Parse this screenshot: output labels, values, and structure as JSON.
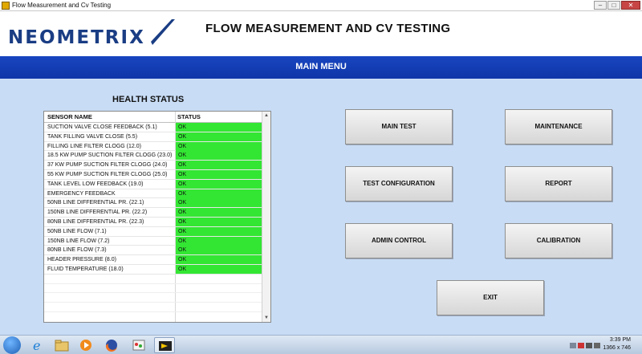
{
  "window": {
    "title": "Flow Measurement and Cv Testing"
  },
  "header": {
    "logo_text": "NEOMETRIX",
    "app_title": "FLOW MEASUREMENT AND CV TESTING"
  },
  "menubar": {
    "title": "MAIN MENU"
  },
  "health": {
    "title": "HEALTH STATUS",
    "columns": [
      "SENSOR NAME",
      "STATUS"
    ],
    "rows": [
      {
        "name": "SUCTION VALVE CLOSE FEEDBACK (5.1)",
        "status": "OK"
      },
      {
        "name": "TANK FILLING VALVE CLOSE (5.5)",
        "status": "OK"
      },
      {
        "name": "FILLING LINE FILTER CLOGG (12.0)",
        "status": "OK"
      },
      {
        "name": "18.5 KW PUMP SUCTION FILTER CLOGG (23.0)",
        "status": "OK"
      },
      {
        "name": "37 KW PUMP SUCTION FILTER CLOGG (24.0)",
        "status": "OK"
      },
      {
        "name": "55 KW PUMP SUCTION FILTER CLOGG (25.0)",
        "status": "OK"
      },
      {
        "name": "TANK LEVEL LOW FEEDBACK (19.0)",
        "status": "OK"
      },
      {
        "name": "EMERGENCY FEEDBACK",
        "status": "OK"
      },
      {
        "name": "50NB LINE DIFFERENTIAL PR. (22.1)",
        "status": "OK"
      },
      {
        "name": "150NB LINE DIFFERENTIAL PR. (22.2)",
        "status": "OK"
      },
      {
        "name": "80NB LINE DIFFERENTIAL PR. (22.3)",
        "status": "OK"
      },
      {
        "name": "50NB LINE FLOW  (7.1)",
        "status": "OK"
      },
      {
        "name": "150NB LINE FLOW  (7.2)",
        "status": "OK"
      },
      {
        "name": "80NB LINE FLOW (7.3)",
        "status": "OK"
      },
      {
        "name": "HEADER PRESSURE (8.0)",
        "status": "OK"
      },
      {
        "name": "FLUID TEMPERATURE (18.0)",
        "status": "OK"
      }
    ],
    "status_color": "#33e633"
  },
  "buttons": {
    "main_test": "MAIN TEST",
    "maintenance": "MAINTENANCE",
    "test_configuration": "TEST CONFIGURATION",
    "report": "REPORT",
    "admin_control": "ADMIN CONTROL",
    "calibration": "CALIBRATION",
    "exit": "EXIT"
  },
  "taskbar": {
    "time": "3:39 PM",
    "resolution": "1366 x 746",
    "items": [
      "start-icon",
      "ie-icon",
      "explorer-icon",
      "media-player-icon",
      "firefox-icon",
      "paint-icon",
      "labview-icon"
    ]
  },
  "colors": {
    "accent_blue": "#1846c0",
    "background": "#c8dcf5",
    "logo": "#1a3d84"
  }
}
